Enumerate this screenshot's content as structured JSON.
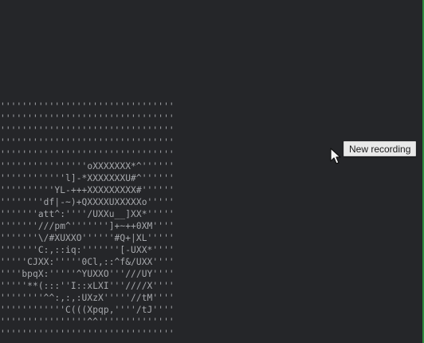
{
  "tooltip": {
    "text": "New recording"
  },
  "ascii_art": {
    "lines": [
      "''''''''''''''''''''''''''''''''",
      "''''''''''''''''''''''''''''''''",
      "''''''''''''''''''''''''''''''''",
      "''''''''''''''''''''''''''''''''",
      "''''''''''''''''''''''''''''''''",
      "''''''''''''''''oXXXXXXX*^''''''",
      "''''''''''''l]-*XXXXXXXU#^''''''",
      "''''''''''YL-+++XXXXXXXXX#''''''",
      "''''''''df|-~)+QXXXXUXXXXXo'''''",
      "'''''''att^:''''/UXXu__]XX*'''''",
      "'''''''///pm^''''''']+~++0XM''''",
      "'''''''\\/#XUXXO''''''#Q+|XL'''''",
      "'''''''C:,::iq:'''''''[-UXX*''''",
      "'''''CJXX:'''''0Cl,::^f&/UXX''''",
      "''''bpqX:'''''^YUXXO'''///UY''''",
      "'''''**(:::''I::xLXI'''////X''''",
      "''''''''^^:,:,:UXzX'''''//tM''''",
      "''''''''''''C(((Xpqp,''''/tJ''''",
      "''''''''''''''''^^''''''''''''''",
      "''''''''''''''''''''''''''''''''"
    ],
    "color": "#a7a9ad"
  },
  "colors": {
    "background": "#252629",
    "edge_accent": "#2f8b3f",
    "tooltip_bg": "#e9e9e9"
  }
}
